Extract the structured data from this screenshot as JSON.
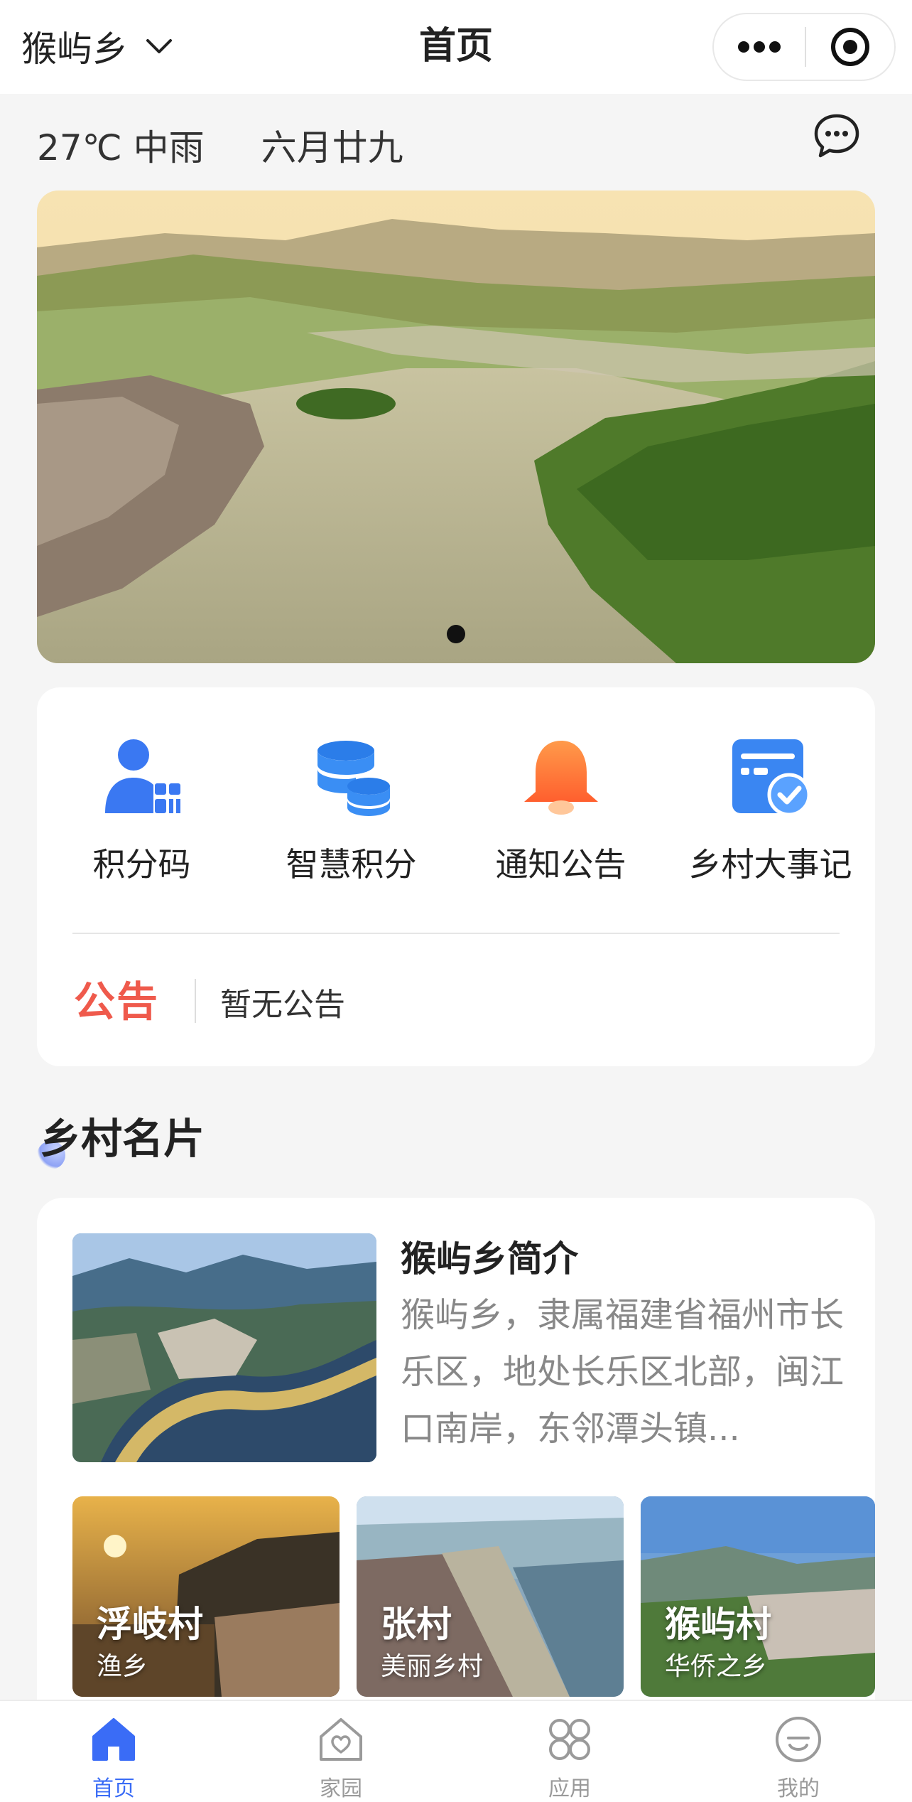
{
  "header": {
    "location": "猴屿乡",
    "title": "首页"
  },
  "weather": {
    "temp": "27℃ 中雨",
    "lunar_date": "六月廿九"
  },
  "banner": {
    "active_index": 0,
    "total": 1
  },
  "quick_actions": [
    {
      "label": "积分码",
      "icon": "user-qrcode-icon"
    },
    {
      "label": "智慧积分",
      "icon": "coins-stack-icon"
    },
    {
      "label": "通知公告",
      "icon": "bell-icon"
    },
    {
      "label": "乡村大事记",
      "icon": "calendar-check-icon"
    }
  ],
  "notice": {
    "tag": "公告",
    "text": "暂无公告"
  },
  "section": {
    "title": "乡村名片"
  },
  "intro": {
    "title": "猴屿乡简介",
    "description": "猴屿乡，隶属福建省福州市长乐区，地处长乐区北部，闽江口南岸，东邻潭头镇..."
  },
  "villages": [
    {
      "name": "浮岐村",
      "subtitle": "渔乡"
    },
    {
      "name": "张村",
      "subtitle": "美丽乡村"
    },
    {
      "name": "猴屿村",
      "subtitle": "华侨之乡"
    }
  ],
  "tabbar": [
    {
      "label": "首页",
      "icon": "home-icon",
      "active": true
    },
    {
      "label": "家园",
      "icon": "house-heart-icon",
      "active": false
    },
    {
      "label": "应用",
      "icon": "apps-grid-icon",
      "active": false
    },
    {
      "label": "我的",
      "icon": "smile-face-icon",
      "active": false
    }
  ],
  "colors": {
    "accent": "#3a6cf6",
    "notice_red": "#ef5a4c",
    "bell_orange": "#ff7a3c"
  }
}
